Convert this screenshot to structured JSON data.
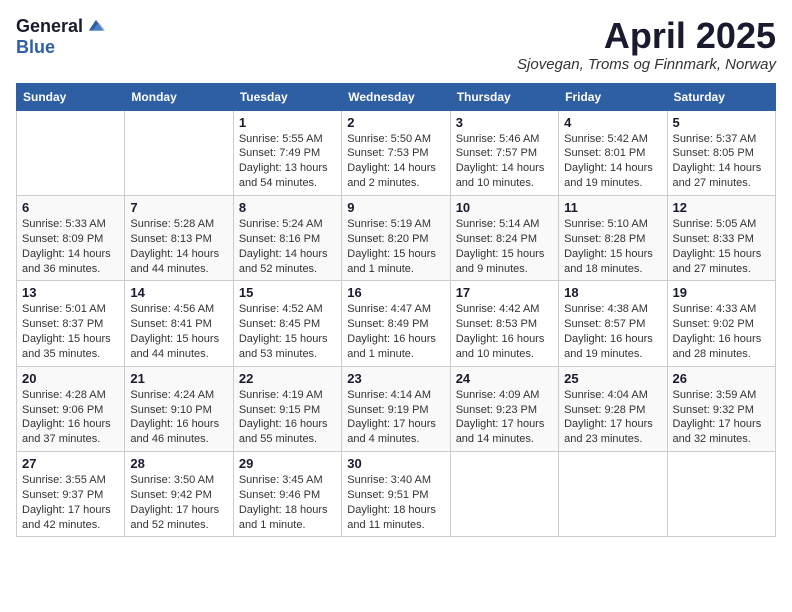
{
  "header": {
    "logo_general": "General",
    "logo_blue": "Blue",
    "title": "April 2025",
    "location": "Sjovegan, Troms og Finnmark, Norway"
  },
  "weekdays": [
    "Sunday",
    "Monday",
    "Tuesday",
    "Wednesday",
    "Thursday",
    "Friday",
    "Saturday"
  ],
  "weeks": [
    [
      {
        "day": "",
        "info": ""
      },
      {
        "day": "",
        "info": ""
      },
      {
        "day": "1",
        "info": "Sunrise: 5:55 AM\nSunset: 7:49 PM\nDaylight: 13 hours and 54 minutes."
      },
      {
        "day": "2",
        "info": "Sunrise: 5:50 AM\nSunset: 7:53 PM\nDaylight: 14 hours and 2 minutes."
      },
      {
        "day": "3",
        "info": "Sunrise: 5:46 AM\nSunset: 7:57 PM\nDaylight: 14 hours and 10 minutes."
      },
      {
        "day": "4",
        "info": "Sunrise: 5:42 AM\nSunset: 8:01 PM\nDaylight: 14 hours and 19 minutes."
      },
      {
        "day": "5",
        "info": "Sunrise: 5:37 AM\nSunset: 8:05 PM\nDaylight: 14 hours and 27 minutes."
      }
    ],
    [
      {
        "day": "6",
        "info": "Sunrise: 5:33 AM\nSunset: 8:09 PM\nDaylight: 14 hours and 36 minutes."
      },
      {
        "day": "7",
        "info": "Sunrise: 5:28 AM\nSunset: 8:13 PM\nDaylight: 14 hours and 44 minutes."
      },
      {
        "day": "8",
        "info": "Sunrise: 5:24 AM\nSunset: 8:16 PM\nDaylight: 14 hours and 52 minutes."
      },
      {
        "day": "9",
        "info": "Sunrise: 5:19 AM\nSunset: 8:20 PM\nDaylight: 15 hours and 1 minute."
      },
      {
        "day": "10",
        "info": "Sunrise: 5:14 AM\nSunset: 8:24 PM\nDaylight: 15 hours and 9 minutes."
      },
      {
        "day": "11",
        "info": "Sunrise: 5:10 AM\nSunset: 8:28 PM\nDaylight: 15 hours and 18 minutes."
      },
      {
        "day": "12",
        "info": "Sunrise: 5:05 AM\nSunset: 8:33 PM\nDaylight: 15 hours and 27 minutes."
      }
    ],
    [
      {
        "day": "13",
        "info": "Sunrise: 5:01 AM\nSunset: 8:37 PM\nDaylight: 15 hours and 35 minutes."
      },
      {
        "day": "14",
        "info": "Sunrise: 4:56 AM\nSunset: 8:41 PM\nDaylight: 15 hours and 44 minutes."
      },
      {
        "day": "15",
        "info": "Sunrise: 4:52 AM\nSunset: 8:45 PM\nDaylight: 15 hours and 53 minutes."
      },
      {
        "day": "16",
        "info": "Sunrise: 4:47 AM\nSunset: 8:49 PM\nDaylight: 16 hours and 1 minute."
      },
      {
        "day": "17",
        "info": "Sunrise: 4:42 AM\nSunset: 8:53 PM\nDaylight: 16 hours and 10 minutes."
      },
      {
        "day": "18",
        "info": "Sunrise: 4:38 AM\nSunset: 8:57 PM\nDaylight: 16 hours and 19 minutes."
      },
      {
        "day": "19",
        "info": "Sunrise: 4:33 AM\nSunset: 9:02 PM\nDaylight: 16 hours and 28 minutes."
      }
    ],
    [
      {
        "day": "20",
        "info": "Sunrise: 4:28 AM\nSunset: 9:06 PM\nDaylight: 16 hours and 37 minutes."
      },
      {
        "day": "21",
        "info": "Sunrise: 4:24 AM\nSunset: 9:10 PM\nDaylight: 16 hours and 46 minutes."
      },
      {
        "day": "22",
        "info": "Sunrise: 4:19 AM\nSunset: 9:15 PM\nDaylight: 16 hours and 55 minutes."
      },
      {
        "day": "23",
        "info": "Sunrise: 4:14 AM\nSunset: 9:19 PM\nDaylight: 17 hours and 4 minutes."
      },
      {
        "day": "24",
        "info": "Sunrise: 4:09 AM\nSunset: 9:23 PM\nDaylight: 17 hours and 14 minutes."
      },
      {
        "day": "25",
        "info": "Sunrise: 4:04 AM\nSunset: 9:28 PM\nDaylight: 17 hours and 23 minutes."
      },
      {
        "day": "26",
        "info": "Sunrise: 3:59 AM\nSunset: 9:32 PM\nDaylight: 17 hours and 32 minutes."
      }
    ],
    [
      {
        "day": "27",
        "info": "Sunrise: 3:55 AM\nSunset: 9:37 PM\nDaylight: 17 hours and 42 minutes."
      },
      {
        "day": "28",
        "info": "Sunrise: 3:50 AM\nSunset: 9:42 PM\nDaylight: 17 hours and 52 minutes."
      },
      {
        "day": "29",
        "info": "Sunrise: 3:45 AM\nSunset: 9:46 PM\nDaylight: 18 hours and 1 minute."
      },
      {
        "day": "30",
        "info": "Sunrise: 3:40 AM\nSunset: 9:51 PM\nDaylight: 18 hours and 11 minutes."
      },
      {
        "day": "",
        "info": ""
      },
      {
        "day": "",
        "info": ""
      },
      {
        "day": "",
        "info": ""
      }
    ]
  ]
}
